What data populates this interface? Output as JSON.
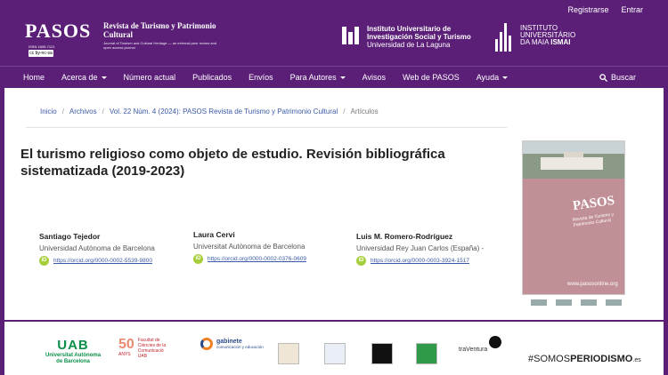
{
  "header": {
    "register": "Registrarse",
    "login": "Entrar",
    "logo": {
      "mark": "PASOS",
      "subtitle": "Revista de Turismo y Patrimonio Cultural",
      "tagline": "Journal of Tourism and Cultural Heritage — an external peer review and open access journal",
      "issn": "ISSN 1695-7121",
      "license": "cc by-nc-sa"
    },
    "institute": {
      "line1": "Instituto Universitario de",
      "line2": "Investigación Social y Turismo",
      "line3": "Universidad de La Laguna"
    },
    "ismai": {
      "line1": "INSTITUTO",
      "line2": "UNIVERSITÁRIO",
      "line3a": "DA MAIA",
      "line3b": "ISMAI"
    }
  },
  "nav": {
    "items": [
      {
        "label": "Home",
        "dropdown": false
      },
      {
        "label": "Acerca de",
        "dropdown": true
      },
      {
        "label": "Número actual",
        "dropdown": false
      },
      {
        "label": "Publicados",
        "dropdown": false
      },
      {
        "label": "Envíos",
        "dropdown": false
      },
      {
        "label": "Para Autores",
        "dropdown": true
      },
      {
        "label": "Avisos",
        "dropdown": false
      },
      {
        "label": "Web de PASOS",
        "dropdown": false
      },
      {
        "label": "Ayuda",
        "dropdown": true
      }
    ],
    "search": "Buscar"
  },
  "breadcrumb": {
    "items": [
      "Inicio",
      "Archivos",
      "Vol. 22 Núm. 4 (2024): PASOS Revista de Turismo y Patrimonio Cultural",
      "Artículos"
    ],
    "separator": "/"
  },
  "article": {
    "title": "El turismo religioso como objeto de estudio. Revisión bibliográfica sistematizada (2019-2023)",
    "authors": [
      {
        "name": "Santiago Tejedor",
        "affiliation": "Universidad Autònoma de Barcelona",
        "orcid": "https://orcid.org/0000-0002-5539-9800"
      },
      {
        "name": "Laura Cervi",
        "affiliation": "Universitat Autònoma de Barcelona",
        "orcid": "https://orcid.org/0000-0002-0376-0609"
      },
      {
        "name": "Luis M. Romero-Rodríguez",
        "affiliation": "Universidad Rey Juan Carlos (España) -",
        "orcid": "https://orcid.org/0000-0003-3924-1517"
      }
    ],
    "orcid_badge": "iD"
  },
  "cover": {
    "title": "PASOS",
    "subtitle": "Revista de Turismo y Patrimonio Cultural",
    "url": "www.pasosonline.org"
  },
  "footer": {
    "uab": {
      "big": "UAB",
      "line1": "Universitat Autònoma",
      "line2": "de Barcelona"
    },
    "anys": {
      "num": "50",
      "sub": "ANYS",
      "l1": "Facultat de",
      "l2": "Ciències de la",
      "l3": "Comunicació",
      "l4": "UAB"
    },
    "gabinete": {
      "t": "gabinete",
      "s": "comunicación y educación"
    },
    "traveltura": "traVentura",
    "somos_a": "#SOMOS",
    "somos_b": "PERIODISMO",
    "somos_c": ".es"
  }
}
